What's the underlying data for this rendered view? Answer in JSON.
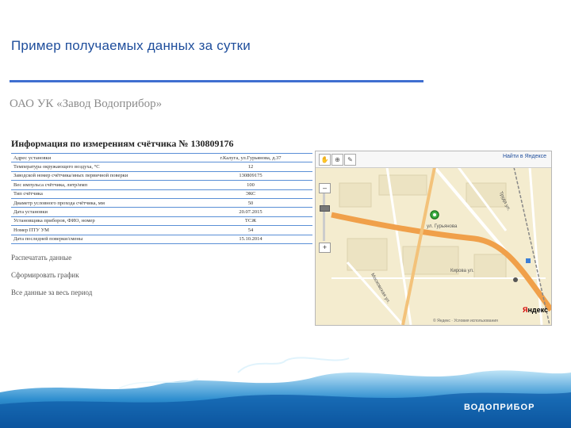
{
  "slide": {
    "title": "Пример получаемых данных за сутки",
    "company": "ОАО УК «Завод Водоприбор»"
  },
  "info": {
    "heading": "Информация по измерениям счётчика № 130809176",
    "rows": [
      {
        "label": "Адрес установки",
        "value": "г.Калуга, ул.Гурьянова, д.37"
      },
      {
        "label": "Температура окружающего воздуха, °С",
        "value": "12"
      },
      {
        "label": "Заводской номер счётчика/иных первичной поверки",
        "value": "130809175"
      },
      {
        "label": "Вес импульса счётчика, литр/имп",
        "value": "100"
      },
      {
        "label": "Тип счётчика",
        "value": "ЭКС"
      },
      {
        "label": "Диаметр условного прохода счётчика, мм",
        "value": "50"
      },
      {
        "label": "Дата установки",
        "value": "20.07.2015"
      },
      {
        "label": "Установщика приборов, ФИО, номер",
        "value": "ТСЖ"
      },
      {
        "label": "Номер ПТУ УМ",
        "value": "54"
      },
      {
        "label": "Дата последней поверки/смены",
        "value": "15.10.2014"
      }
    ]
  },
  "links": {
    "print": "Распечатать данные",
    "graph": "Сформировать график",
    "all_data": "Все данные за весь период"
  },
  "map": {
    "search_label": "Найти в Яндексе",
    "footer": "© Яндекс · Условия использования",
    "logo_a": "Я",
    "logo_b": "ндекс",
    "streets": [
      "ул. Гурьянова",
      "Московская ул.",
      "Кирова ул.",
      "Труда ул."
    ],
    "zoom_in": "+",
    "zoom_out": "–"
  },
  "brand": {
    "name": "ВОДОПРИБОР"
  },
  "colors": {
    "title": "#1f4e9c",
    "rule": "#3f6fd0",
    "map_bg": "#f4eccf",
    "road": "#f0a04a"
  }
}
